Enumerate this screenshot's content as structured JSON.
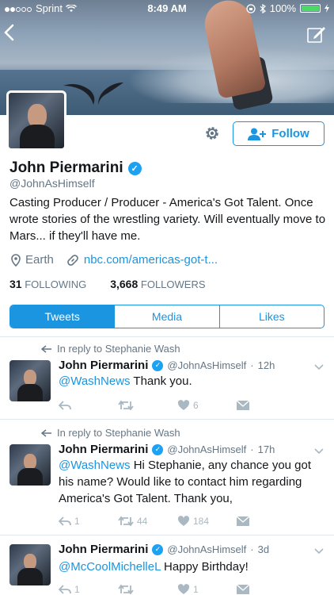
{
  "status_bar": {
    "carrier": "Sprint",
    "time": "8:49 AM",
    "battery": "100%"
  },
  "profile": {
    "name": "John Piermarini",
    "handle": "@JohnAsHimself",
    "bio": "Casting Producer / Producer - America's Got Talent. Once wrote stories of the wrestling variety. Will eventually move to Mars... if they'll have me.",
    "location": "Earth",
    "website": "nbc.com/americas-got-t...",
    "following_count": "31",
    "following_label": "FOLLOWING",
    "followers_count": "3,668",
    "followers_label": "FOLLOWERS",
    "follow_label": "Follow"
  },
  "tabs": [
    "Tweets",
    "Media",
    "Likes"
  ],
  "active_tab": "Tweets",
  "tweets": [
    {
      "reply_to": "In reply to Stephanie Wash",
      "name": "John Piermarini",
      "handle": "@JohnAsHimself",
      "time": "12h",
      "mention": "@WashNews",
      "text": " Thank you.",
      "reply_count": "",
      "retweet_count": "",
      "like_count": "6"
    },
    {
      "reply_to": "In reply to Stephanie Wash",
      "name": "John Piermarini",
      "handle": "@JohnAsHimself",
      "time": "17h",
      "mention": "@WashNews",
      "text": " Hi Stephanie, any chance you got his name? Would like to contact him regarding America's Got Talent. Thank you,",
      "reply_count": "1",
      "retweet_count": "44",
      "like_count": "184"
    },
    {
      "reply_to": "",
      "name": "John Piermarini",
      "handle": "@JohnAsHimself",
      "time": "3d",
      "mention": "@McCoolMichelleL",
      "text": " Happy Birthday!",
      "reply_count": "1",
      "retweet_count": "",
      "like_count": "1"
    }
  ],
  "colors": {
    "accent": "#1b95e0",
    "verified": "#1da1f2",
    "muted": "#657786",
    "icon": "#aab8c2"
  }
}
